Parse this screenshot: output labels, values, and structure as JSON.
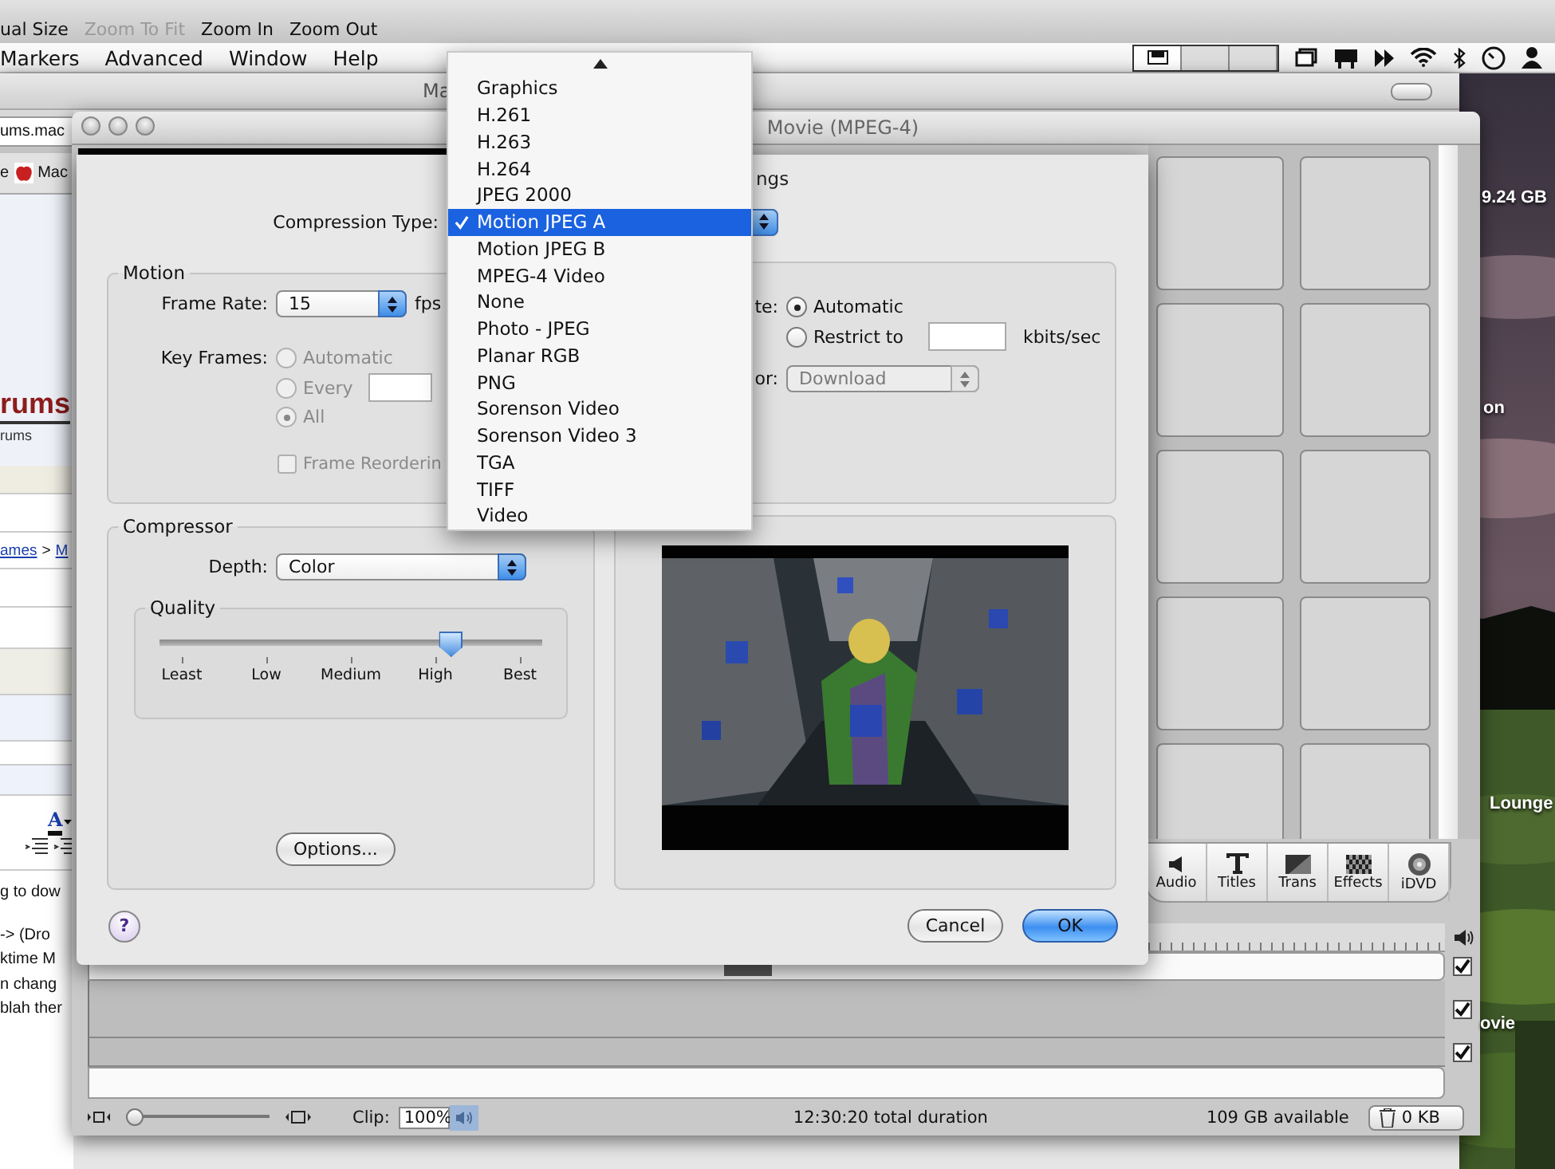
{
  "toolbar": [
    {
      "label": "ual Size",
      "disabled": false
    },
    {
      "label": "Zoom To Fit",
      "disabled": true
    },
    {
      "label": "Zoom In",
      "disabled": false
    },
    {
      "label": "Zoom Out",
      "disabled": false
    }
  ],
  "menu_bar": [
    "Markers",
    "Advanced",
    "Window",
    "Help"
  ],
  "browser_window": {
    "title_start": "Ma",
    "address": "ums.mac",
    "bookmarks": [
      "e",
      "Mac"
    ],
    "site_logo": "rums",
    "site_tagline": "rums",
    "breadcrumb": [
      "ames",
      ">",
      "M"
    ],
    "text_color_button": "A",
    "post_lines": [
      "g to dow",
      "-> (Dro",
      "ktime M",
      "n chang",
      "blah ther"
    ]
  },
  "imovie_window": {
    "title": "Movie (MPEG-4)",
    "tools": [
      {
        "label": "Audio",
        "kind": "audio"
      },
      {
        "label": "Titles",
        "kind": "titles"
      },
      {
        "label": "Trans",
        "kind": "trans"
      },
      {
        "label": "Effects",
        "kind": "effects"
      },
      {
        "label": "iDVD",
        "kind": "dvd"
      }
    ],
    "tracks": [
      {
        "checked": true
      },
      {
        "checked": true
      },
      {
        "checked": true
      }
    ],
    "zoom_slider": {
      "level": 0
    },
    "clip_label": "Clip:",
    "clip_volume": "100%",
    "duration": "12:30:20 total duration",
    "free_space": "109 GB available",
    "trash": "0 KB"
  },
  "desktop_labels": [
    "9.24 GB",
    "on",
    "Lounge",
    "ovie"
  ],
  "dialog": {
    "title": "ngs",
    "compression_type_label": "Compression Type:",
    "motion": {
      "title": "Motion",
      "frame_rate_label": "Frame Rate:",
      "frame_rate": "15",
      "fps_label": "fps",
      "key_frames_label": "Key Frames:",
      "key_frame_options": [
        {
          "label": "Automatic",
          "selected": false,
          "disabled": true
        },
        {
          "label": "Every",
          "selected": false,
          "disabled": true
        },
        {
          "label": "All",
          "selected": true,
          "disabled": true
        }
      ],
      "frame_reordering": {
        "label": "Frame Reorderin",
        "checked": false,
        "disabled": true
      }
    },
    "data_rate": {
      "label": "te:",
      "options": [
        {
          "label": "Automatic",
          "selected": true,
          "disabled": false
        },
        {
          "label": "Restrict to",
          "selected": false,
          "disabled": false
        }
      ],
      "unit": "kbits/sec",
      "optimized_label": "or:",
      "optimized_for": "Download",
      "optimized_disabled": true
    },
    "compressor": {
      "title": "Compressor",
      "depth_label": "Depth:",
      "depth": "Color",
      "quality": {
        "title": "Quality",
        "level": 0.76,
        "ticks": [
          "Least",
          "Low",
          "Medium",
          "High",
          "Best"
        ]
      },
      "options_button": "Options..."
    },
    "help": "?",
    "buttons": [
      {
        "label": "Cancel",
        "default": false
      },
      {
        "label": "OK",
        "default": true
      }
    ]
  },
  "compression_menu": {
    "items": [
      {
        "label": "Graphics",
        "selected": false
      },
      {
        "label": "H.261",
        "selected": false
      },
      {
        "label": "H.263",
        "selected": false
      },
      {
        "label": "H.264",
        "selected": false
      },
      {
        "label": "JPEG 2000",
        "selected": false
      },
      {
        "label": "Motion JPEG A",
        "selected": true
      },
      {
        "label": "Motion JPEG B",
        "selected": false
      },
      {
        "label": "MPEG-4 Video",
        "selected": false
      },
      {
        "label": "None",
        "selected": false
      },
      {
        "label": "Photo - JPEG",
        "selected": false
      },
      {
        "label": "Planar RGB",
        "selected": false
      },
      {
        "label": "PNG",
        "selected": false
      },
      {
        "label": "Sorenson Video",
        "selected": false
      },
      {
        "label": "Sorenson Video 3",
        "selected": false
      },
      {
        "label": "TGA",
        "selected": false
      },
      {
        "label": "TIFF",
        "selected": false
      },
      {
        "label": "Video",
        "selected": false
      }
    ]
  }
}
